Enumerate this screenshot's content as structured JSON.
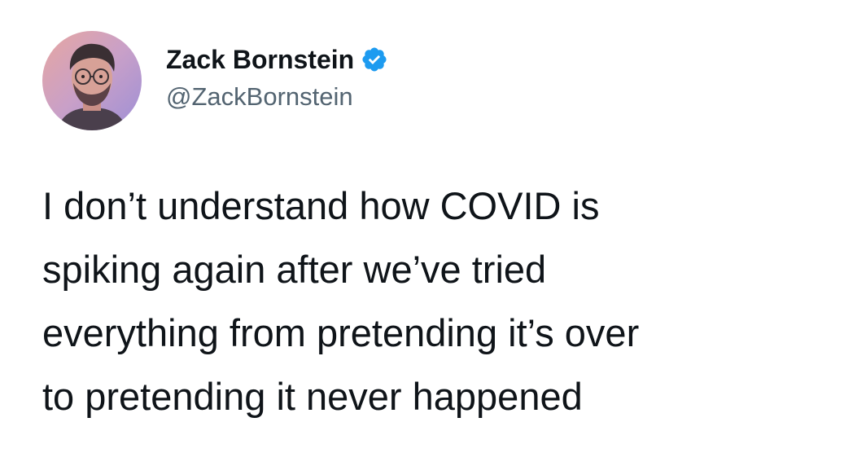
{
  "author": {
    "display_name": "Zack Bornstein",
    "handle": "@ZackBornstein",
    "verified": true,
    "avatar_icon": "avatar-photo-icon",
    "verified_icon": "verified-badge-icon"
  },
  "tweet": {
    "lines": [
      "I don’t understand how COVID is",
      "spiking again after we’ve tried",
      "everything from pretending it’s over",
      "to pretending it never happened"
    ]
  },
  "colors": {
    "text": "#0f1419",
    "handle": "#536471",
    "verified": "#1d9bf0",
    "background": "#ffffff"
  }
}
